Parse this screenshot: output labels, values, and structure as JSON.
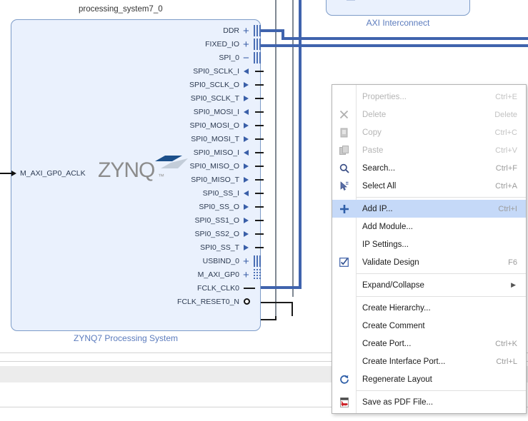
{
  "diagram": {
    "block_title": "processing_system7_0",
    "block_subtitle": "ZYNQ7 Processing System",
    "logo_text": "ZYNQ",
    "logo_tm": "™",
    "left_port": "M_AXI_GP0_ACLK",
    "axi_block_caption": "AXI Interconnect",
    "colors": {
      "block_fill": "#eaf1fd",
      "block_border": "#7d9cc8",
      "wire_blue": "#3f63ad",
      "port_text": "#2d3b52",
      "caption_blue": "#5b7bbd",
      "highlight": "#c5d9f8"
    },
    "ports": [
      {
        "name": "DDR",
        "type": "bus",
        "marker": "plus"
      },
      {
        "name": "FIXED_IO",
        "type": "bus",
        "marker": "plus"
      },
      {
        "name": "SPI_0",
        "type": "bus",
        "marker": "minus"
      },
      {
        "name": "SPI0_SCLK_I",
        "type": "in",
        "marker": "arrow-left"
      },
      {
        "name": "SPI0_SCLK_O",
        "type": "out",
        "marker": "arrow-right"
      },
      {
        "name": "SPI0_SCLK_T",
        "type": "out",
        "marker": "arrow-right"
      },
      {
        "name": "SPI0_MOSI_I",
        "type": "in",
        "marker": "arrow-left"
      },
      {
        "name": "SPI0_MOSI_O",
        "type": "out",
        "marker": "arrow-right"
      },
      {
        "name": "SPI0_MOSI_T",
        "type": "out",
        "marker": "arrow-right"
      },
      {
        "name": "SPI0_MISO_I",
        "type": "in",
        "marker": "arrow-left"
      },
      {
        "name": "SPI0_MISO_O",
        "type": "out",
        "marker": "arrow-right"
      },
      {
        "name": "SPI0_MISO_T",
        "type": "out",
        "marker": "arrow-right"
      },
      {
        "name": "SPI0_SS_I",
        "type": "in",
        "marker": "arrow-left"
      },
      {
        "name": "SPI0_SS_O",
        "type": "out",
        "marker": "arrow-right"
      },
      {
        "name": "SPI0_SS1_O",
        "type": "out",
        "marker": "arrow-right"
      },
      {
        "name": "SPI0_SS2_O",
        "type": "out",
        "marker": "arrow-right"
      },
      {
        "name": "SPI0_SS_T",
        "type": "out",
        "marker": "arrow-right"
      },
      {
        "name": "USBIND_0",
        "type": "bus",
        "marker": "plus"
      },
      {
        "name": "M_AXI_GP0",
        "type": "bus",
        "marker": "plus"
      },
      {
        "name": "FCLK_CLK0",
        "type": "out",
        "marker": "none"
      },
      {
        "name": "FCLK_RESET0_N",
        "type": "out",
        "marker": "circle"
      }
    ]
  },
  "context_menu": {
    "items": [
      {
        "label": "Properties...",
        "shortcut": "Ctrl+E",
        "icon": "none",
        "disabled": true,
        "selected": false,
        "sep_after": false
      },
      {
        "label": "Delete",
        "shortcut": "Delete",
        "icon": "delete-x",
        "disabled": true,
        "selected": false,
        "sep_after": false
      },
      {
        "label": "Copy",
        "shortcut": "Ctrl+C",
        "icon": "copy",
        "disabled": true,
        "selected": false,
        "sep_after": false
      },
      {
        "label": "Paste",
        "shortcut": "Ctrl+V",
        "icon": "paste",
        "disabled": true,
        "selected": false,
        "sep_after": false
      },
      {
        "label": "Search...",
        "shortcut": "Ctrl+F",
        "icon": "search",
        "disabled": false,
        "selected": false,
        "sep_after": false
      },
      {
        "label": "Select All",
        "shortcut": "Ctrl+A",
        "icon": "select-all",
        "disabled": false,
        "selected": false,
        "sep_after": true
      },
      {
        "label": "Add IP...",
        "shortcut": "Ctrl+I",
        "icon": "plus",
        "disabled": false,
        "selected": true,
        "sep_after": false
      },
      {
        "label": "Add Module...",
        "shortcut": "",
        "icon": "none",
        "disabled": false,
        "selected": false,
        "sep_after": false
      },
      {
        "label": "IP Settings...",
        "shortcut": "",
        "icon": "none",
        "disabled": false,
        "selected": false,
        "sep_after": false
      },
      {
        "label": "Validate Design",
        "shortcut": "F6",
        "icon": "validate",
        "disabled": false,
        "selected": false,
        "sep_after": true
      },
      {
        "label": "Expand/Collapse",
        "shortcut": "",
        "icon": "none",
        "disabled": false,
        "selected": false,
        "submenu": true,
        "sep_after": true
      },
      {
        "label": "Create Hierarchy...",
        "shortcut": "",
        "icon": "none",
        "disabled": false,
        "selected": false,
        "sep_after": false
      },
      {
        "label": "Create Comment",
        "shortcut": "",
        "icon": "none",
        "disabled": false,
        "selected": false,
        "sep_after": false
      },
      {
        "label": "Create Port...",
        "shortcut": "Ctrl+K",
        "icon": "none",
        "disabled": false,
        "selected": false,
        "sep_after": false
      },
      {
        "label": "Create Interface Port...",
        "shortcut": "Ctrl+L",
        "icon": "none",
        "disabled": false,
        "selected": false,
        "sep_after": false
      },
      {
        "label": "Regenerate Layout",
        "shortcut": "",
        "icon": "refresh",
        "disabled": false,
        "selected": false,
        "sep_after": true
      },
      {
        "label": "Save as PDF File...",
        "shortcut": "",
        "icon": "pdf",
        "disabled": false,
        "selected": false,
        "sep_after": false
      }
    ]
  }
}
